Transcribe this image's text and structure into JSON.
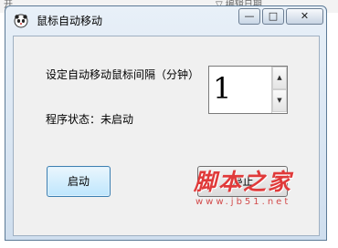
{
  "desktop": {
    "left_text": "开",
    "right_text": "▽  编辑日期"
  },
  "window": {
    "title": "鼠标自动移动",
    "icon": "panda-app-icon",
    "controls": {
      "minimize": "—",
      "maximize": "□",
      "close": "✕"
    }
  },
  "form": {
    "interval_label": "设定自动移动鼠标间隔（分钟）",
    "interval_value": "1",
    "status_label": "程序状态：",
    "status_value": "未启动",
    "start_label": "启动",
    "stop_label": "停止"
  },
  "watermark": {
    "title": "脚本之家",
    "url": "www.jb51.net",
    "color": "#e03a3a"
  }
}
